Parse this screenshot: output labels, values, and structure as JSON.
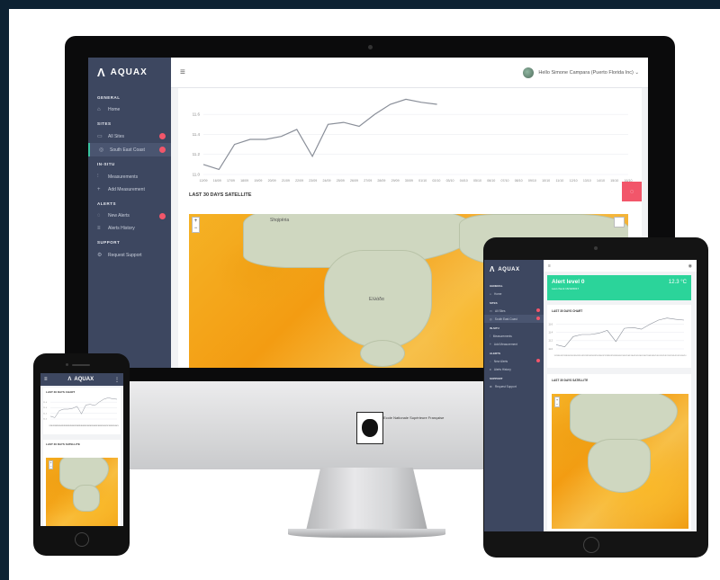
{
  "app": {
    "brand_logo": "Λ",
    "brand_name": "AQUAX",
    "user_greeting": "Hello Simone Campara (Puerto Florida Inc) ⌄"
  },
  "sidebar": {
    "sections": [
      {
        "title": "GENERAL",
        "items": [
          {
            "label": "Home",
            "icon": "home-icon",
            "glyph": "⌂"
          }
        ]
      },
      {
        "title": "SITES",
        "items": [
          {
            "label": "All Sites",
            "icon": "sites-icon",
            "glyph": "▭",
            "badge": true
          },
          {
            "label": "South East Coast",
            "icon": "location-icon",
            "glyph": "◎",
            "badge": true,
            "active": true
          }
        ]
      },
      {
        "title": "IN-SITU",
        "items": [
          {
            "label": "Measurements",
            "icon": "measure-icon",
            "glyph": "⫶"
          },
          {
            "label": "Add Measurement",
            "icon": "plus-icon",
            "glyph": "+"
          }
        ]
      },
      {
        "title": "ALERTS",
        "items": [
          {
            "label": "New Alerts",
            "icon": "bell-icon",
            "glyph": "◌",
            "badge": true
          },
          {
            "label": "Alerts History",
            "icon": "history-icon",
            "glyph": "≡"
          }
        ]
      },
      {
        "title": "SUPPORT",
        "items": [
          {
            "label": "Request Support",
            "icon": "gear-icon",
            "glyph": "⚙"
          }
        ]
      }
    ]
  },
  "chart": {
    "y_ticks": [
      "11.6",
      "11.4",
      "11.2",
      "11.0"
    ],
    "x_ticks": [
      "12/09",
      "16/09",
      "17/09",
      "18/09",
      "19/09",
      "20/09",
      "21/09",
      "22/09",
      "23/09",
      "24/09",
      "25/09",
      "26/09",
      "27/09",
      "28/09",
      "29/09",
      "30/09",
      "01/10",
      "02/10",
      "03/10",
      "04/10",
      "05/10",
      "06/10",
      "07/10",
      "08/10",
      "09/10",
      "10/10",
      "11/10",
      "12/10",
      "13/10",
      "14/10",
      "15/10",
      "16/10"
    ]
  },
  "chart_data": {
    "type": "line",
    "title": "",
    "xlabel": "",
    "ylabel": "",
    "ylim": [
      11.0,
      11.7
    ],
    "x": [
      "12/09",
      "16/09",
      "17/09",
      "18/09",
      "19/09",
      "20/09",
      "21/09",
      "22/09",
      "23/09",
      "24/09",
      "25/09",
      "26/09",
      "27/09",
      "28/09",
      "29/09",
      "30/09"
    ],
    "series": [
      {
        "values": [
          11.1,
          11.05,
          11.3,
          11.35,
          11.35,
          11.38,
          11.45,
          11.18,
          11.5,
          11.52,
          11.48,
          11.6,
          11.7,
          11.75,
          11.72,
          11.7
        ]
      }
    ]
  },
  "satellite": {
    "title": "LAST 30 DAYS SATELLITE",
    "map_labels": [
      "Shqipëria",
      "Ελλάδα"
    ]
  },
  "tablet": {
    "alert_level": "Alert level 0",
    "alert_sub": "Last check 16/10/2017",
    "temperature": "12.3 °C",
    "chart_title": "LAST 30 DAYS CHART",
    "sat_title": "LAST 30 DAYS SATELLITE"
  },
  "phone": {
    "chart_title": "LAST 30 DAYS CHART",
    "sat_title": "LAST 30 DAYS SATELLITE"
  },
  "imac_logo_text": "Ecole Nationale Supérieure Française"
}
